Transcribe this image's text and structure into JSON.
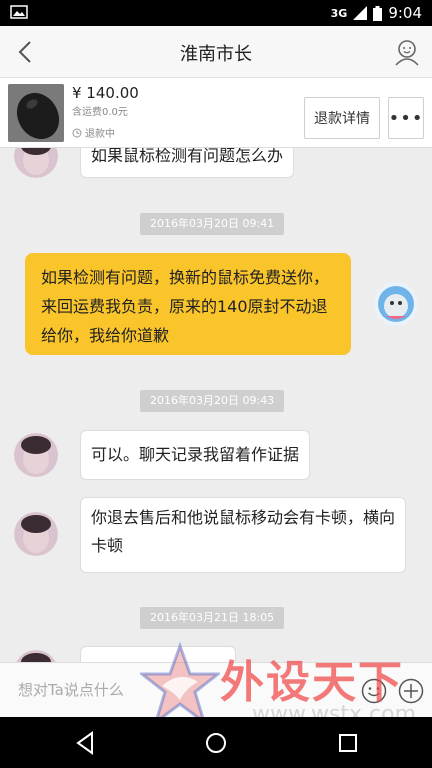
{
  "status_bar": {
    "network": "3G",
    "time": "9:04"
  },
  "header": {
    "title": "淮南市长"
  },
  "order": {
    "price": "¥ 140.00",
    "shipping": "含运费0.0元",
    "status": "退款中",
    "refund_detail_label": "退款详情",
    "more_label": "•••"
  },
  "chat": {
    "partial_message": "如果鼠标检测有问题怎么办",
    "ts1": "2016年03月20日 09:41",
    "self_message": "如果检测有问题，换新的鼠标免费送你，来回运费我负责，原来的140原封不动退给你，我给你道歉",
    "ts2": "2016年03月20日 09:43",
    "msg2": "可以。聊天记录我留着作证据",
    "msg3": "你退去售后和他说鼠标移动会有卡顿，横向卡顿",
    "ts3": "2016年03月21日 18:05"
  },
  "input": {
    "placeholder": "想对Ta说点什么"
  },
  "watermark": {
    "text": "外设天下",
    "url": "www.wstx.com"
  },
  "colors": {
    "self_bubble": "#f9c52b",
    "timestamp_bg": "#cfcfcf"
  }
}
